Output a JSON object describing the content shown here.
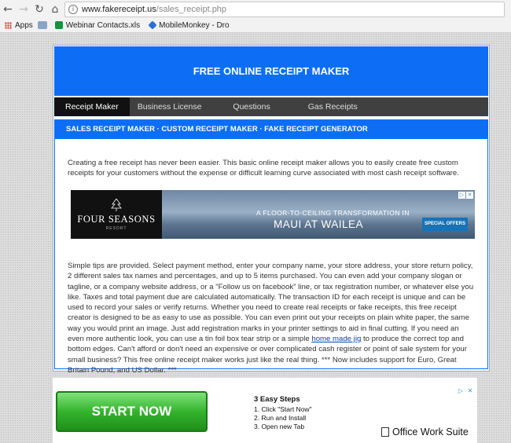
{
  "browser": {
    "url_host": "www.fakereceipt.us",
    "url_path": "/sales_receipt.php",
    "bookmarks": [
      {
        "label": "Apps"
      },
      {
        "label": "Webinar Contacts.xls"
      },
      {
        "label": "MobileMonkey - Dro"
      }
    ]
  },
  "header": {
    "title": "FREE ONLINE RECEIPT MAKER"
  },
  "nav": {
    "tabs": [
      {
        "label": "Receipt Maker",
        "active": true
      },
      {
        "label": "Business License",
        "active": false
      },
      {
        "label": "Questions",
        "active": false
      },
      {
        "label": "Gas Receipts",
        "active": false
      }
    ]
  },
  "subheader": {
    "text": "SALES RECEIPT MAKER · CUSTOM RECEIPT MAKER · FAKE RECEIPT GENERATOR"
  },
  "content": {
    "intro": "Creating a free receipt has never been easier. This basic online receipt maker allows you to easily create free custom receipts for your customers without the expense or difficult learning curve associated with most cash receipt software.",
    "body_before_link": "Simple tips are provided. Select payment method, enter your company name, your store address, your store return policy, 2 different sales tax names and percentages, and up to 5 items purchased. You can even add your company slogan or tagline, or a company website address, or a \"Follow us on facebook\" line, or tax registration number, or whatever else you like. Taxes and total payment due are calculated automatically. The transaction ID for each receipt is unique and can be used to record your sales or verify returns. Whether you need to create real receipts or fake receipts, this free receipt creator is designed to be as easy to use as possible. You can even print out your receipts on plain white paper, the same way you would print an image. Just add registration marks in your printer settings to aid in final cutting. If you need an even more authentic look, you can use a tin foil box tear strip or a simple ",
    "link_text": "home made jig",
    "body_after_link": " to produce the correct top and bottom edges. Can't afford or don't need an expensive or over complicated cash register or point of sale system for your small business? This free online receipt maker works just like the real thing. *** Now includes support for Euro, Great Britain Pound, and US Dollar. ***"
  },
  "ad_banner": {
    "brand": "FOUR SEASONS",
    "resort": "RESORT",
    "headline": "A FLOOR-TO-CEILING TRANSFORMATION IN",
    "location": "MAUI AT WAILEA",
    "offer_button": "SPECIAL OFFERS"
  },
  "lower_ad": {
    "button": "START NOW",
    "steps_title": "3 Easy Steps",
    "steps": [
      "1. Click \"Start Now\"",
      "2. Run and Install",
      "3. Open new Tab"
    ],
    "brand": "Office Work Suite"
  },
  "colors": {
    "accent": "#0d6ef5",
    "nav_bg": "#404040",
    "nav_active": "#111111"
  }
}
